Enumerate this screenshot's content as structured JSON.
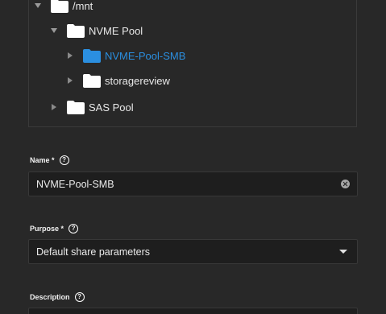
{
  "tree": {
    "items": [
      {
        "label": "/mnt",
        "expanded": true
      },
      {
        "label": "NVME Pool",
        "expanded": true
      },
      {
        "label": "NVME-Pool-SMB",
        "expanded": false,
        "selected": true
      },
      {
        "label": "storagereview",
        "expanded": false
      },
      {
        "label": "SAS Pool",
        "expanded": false
      }
    ]
  },
  "form": {
    "name": {
      "label": "Name *",
      "value": "NVME-Pool-SMB"
    },
    "purpose": {
      "label": "Purpose *",
      "value": "Default share parameters"
    },
    "description": {
      "label": "Description"
    }
  },
  "colors": {
    "accent": "#2b8fe0",
    "background": "#282828",
    "input_bg": "#1e1e1e"
  },
  "icons": {
    "help": "?"
  }
}
